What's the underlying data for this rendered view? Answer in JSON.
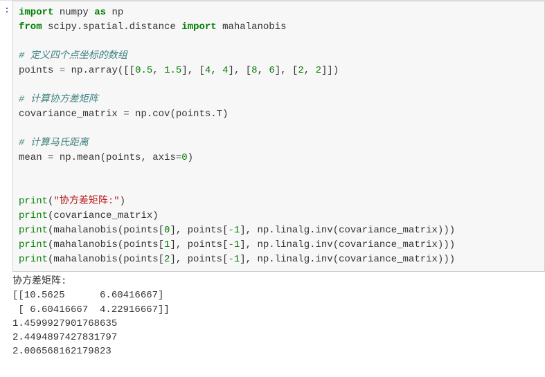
{
  "prompt": ":",
  "code": {
    "l1_import": "import",
    "l1_numpy": "numpy",
    "l1_as": "as",
    "l1_np": "np",
    "l2_from": "from",
    "l2_module": "scipy.spatial.distance",
    "l2_import": "import",
    "l2_maha": "mahalanobis",
    "c1": "# 定义四个点坐标的数组",
    "l4_points": "points",
    "l4_eq": "=",
    "l4_nparray": "np.array([[",
    "l4_v1": "0.5",
    "l4_v2": "1.5",
    "l4_mid1": "], [",
    "l4_v3": "4",
    "l4_v4": "4",
    "l4_mid2": "], [",
    "l4_v5": "8",
    "l4_v6": "6",
    "l4_mid3": "], [",
    "l4_v7": "2",
    "l4_v8": "2",
    "l4_end": "]])",
    "c2": "# 计算协方差矩阵",
    "l6_cov": "covariance_matrix",
    "l6_eq": "=",
    "l6_call": "np.cov(points.T)",
    "c3": "# 计算马氏距离",
    "l8_mean": "mean",
    "l8_eq": "=",
    "l8_call_a": "np.mean(points, axis",
    "l8_eq2": "=",
    "l8_zero": "0",
    "l8_close": ")",
    "l10_print": "print",
    "l10_str": "\"协方差矩阵:\"",
    "l11_print": "print",
    "l11_arg": "(covariance_matrix)",
    "l12_print": "print",
    "l12_arg_a": "(mahalanobis(points[",
    "l12_i0": "0",
    "l12_arg_b": "], points[",
    "l12_neg": "-",
    "l12_i1": "1",
    "l12_arg_c": "], np.linalg.inv(covariance_matrix)))",
    "l13_print": "print",
    "l13_i0": "1",
    "l14_print": "print",
    "l14_i0": "2"
  },
  "output": {
    "line1": "协方差矩阵:",
    "line2": "[[10.5625      6.60416667]",
    "line3": " [ 6.60416667  4.22916667]]",
    "line4": "1.4599927901768635",
    "line5": "2.4494897427831797",
    "line6": "2.006568162179823"
  },
  "chart_data": {
    "type": "table",
    "title": "Python code cell computing Mahalanobis distances",
    "points": [
      [
        0.5,
        1.5
      ],
      [
        4,
        4
      ],
      [
        8,
        6
      ],
      [
        2,
        2
      ]
    ],
    "covariance_matrix": [
      [
        10.5625,
        6.60416667
      ],
      [
        6.60416667,
        4.22916667
      ]
    ],
    "mahalanobis_distances": {
      "points[0]_to_points[-1]": 1.4599927901768635,
      "points[1]_to_points[-1]": 2.4494897427831797,
      "points[2]_to_points[-1]": 2.006568162179823
    }
  }
}
